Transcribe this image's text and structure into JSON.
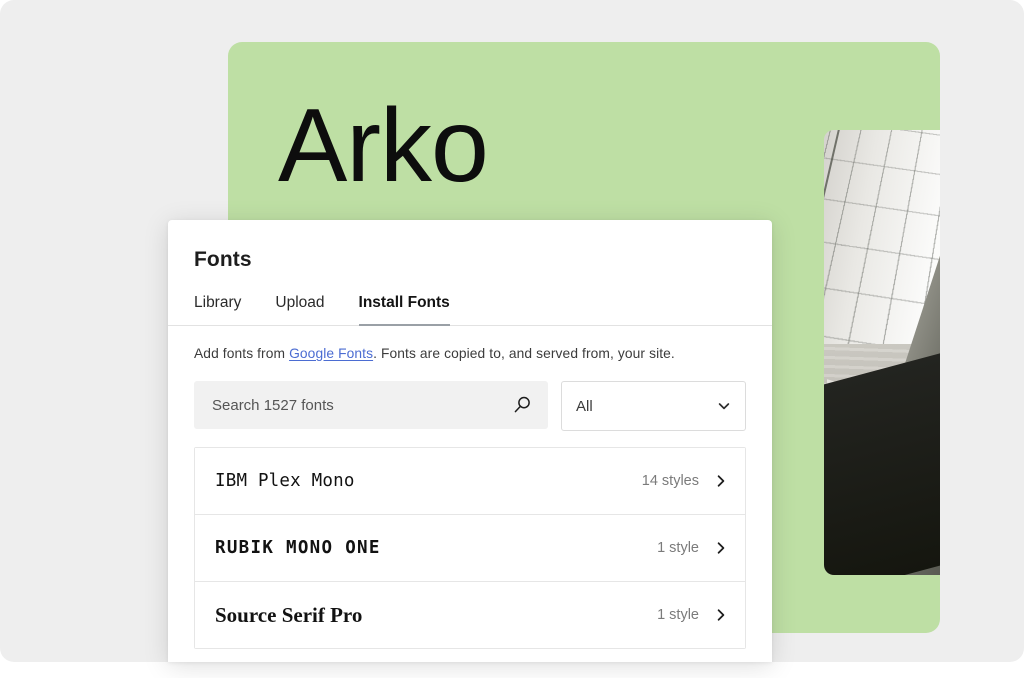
{
  "promo": {
    "title": "Arko",
    "background_color": "#bedfa4",
    "photo_alt": "architectural-interior-photo"
  },
  "dialog": {
    "title": "Fonts",
    "tabs": [
      {
        "label": "Library",
        "active": false
      },
      {
        "label": "Upload",
        "active": false
      },
      {
        "label": "Install Fonts",
        "active": true
      }
    ],
    "blurb": {
      "before_link": "Add fonts from ",
      "link": "Google Fonts",
      "after_link": ". Fonts are copied to, and served from, your site."
    },
    "search": {
      "placeholder": "Search 1527 fonts",
      "value": "",
      "icon": "search-icon"
    },
    "filter": {
      "value": "All",
      "icon": "chevron-down-icon"
    },
    "fonts": [
      {
        "name": "IBM Plex Mono",
        "styles": "14 styles",
        "style_class": "mono"
      },
      {
        "name": "RUBIK MONO ONE",
        "styles": "1 style",
        "style_class": "mono-bold"
      },
      {
        "name": "Source Serif Pro",
        "styles": "1 style",
        "style_class": "serif"
      }
    ],
    "row_icon": "chevron-right-icon"
  },
  "colors": {
    "page_background": "#eeeeee",
    "promo_green": "#bedfa4",
    "link_blue": "#4b6cd2",
    "tab_underline": "#9aa0a6",
    "muted_text": "#7b7b7b"
  }
}
